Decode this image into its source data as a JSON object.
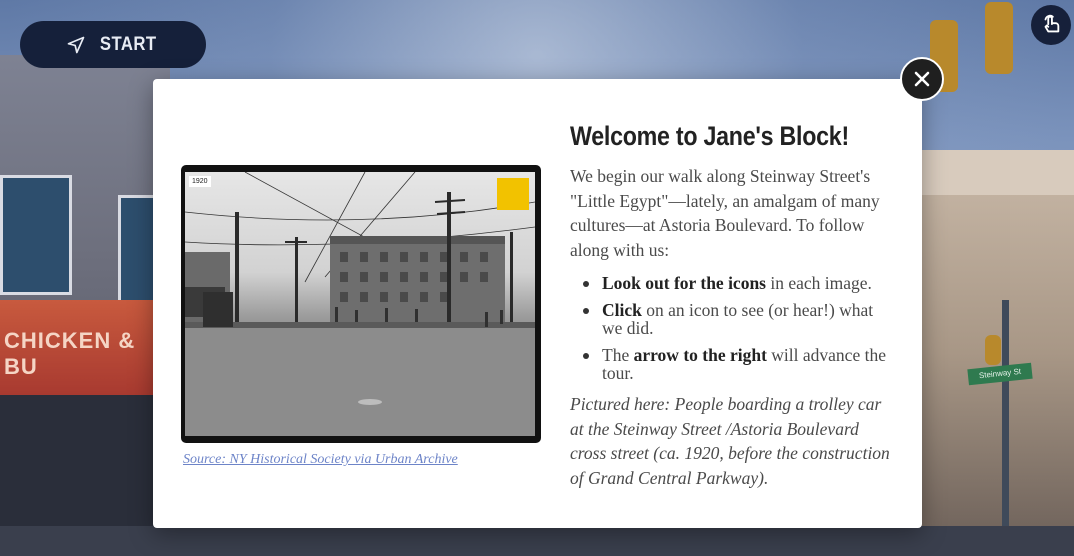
{
  "toolbar": {
    "start_label": "START",
    "start_icon": "navigation-arrow-icon",
    "corner_icon": "touch-hand-icon"
  },
  "background": {
    "shop_sign": "CHICKEN & BU",
    "street_sign": "Steinway St"
  },
  "modal": {
    "close_icon": "close-icon",
    "photo": {
      "badge": "1920",
      "caption": "Source: NY Historical Society via Urban Archive"
    },
    "title": "Welcome to Jane's Block!",
    "intro": "We begin our walk along Steinway Street's \"Little Egypt\"—lately, an amalgam of many cultures—at Astoria Boulevard. To follow along with us:",
    "tips": [
      {
        "bold": "Look out for the icons",
        "rest": " in each image.",
        "lead": ""
      },
      {
        "bold": "Click",
        "rest": " on an icon to see (or hear!) what we did.",
        "lead": ""
      },
      {
        "lead": "The ",
        "bold": "arrow to the right",
        "rest": " will advance the tour."
      }
    ],
    "pictured": "Pictured here: People boarding a trolley car at the Steinway Street /Astoria Boulevard cross street (ca. 1920, before the construction of Grand Central Parkway)."
  },
  "colors": {
    "button_bg": "#15203a",
    "link": "#6d84c8",
    "modal_bg": "#ffffff",
    "title": "#222222",
    "body_text": "#4a4a4a"
  }
}
